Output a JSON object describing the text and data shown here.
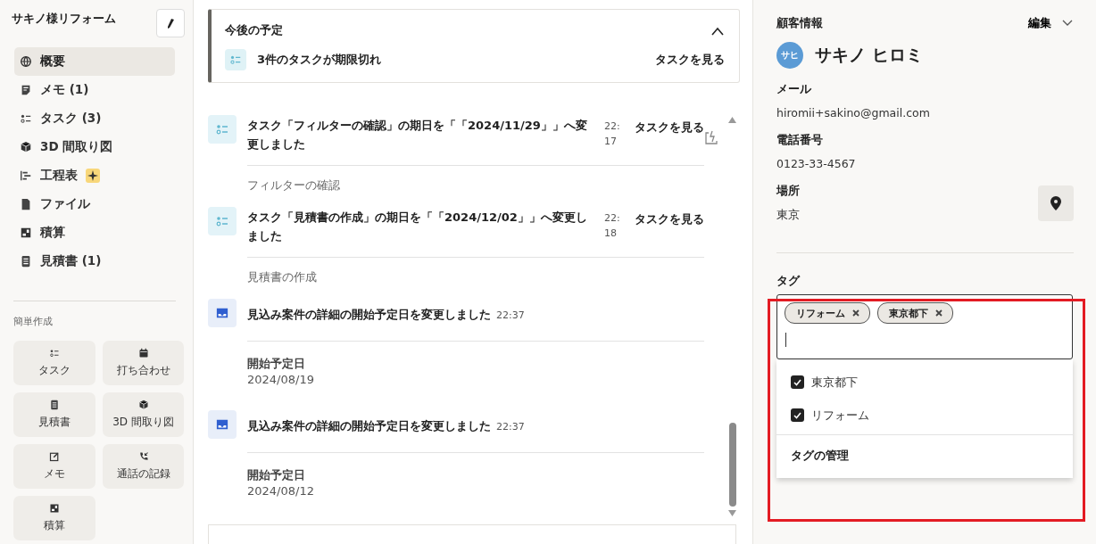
{
  "sidebar": {
    "title": "サキノ様リフォーム",
    "nav_items": [
      {
        "label": "概要",
        "selected": true
      },
      {
        "label": "メモ (1)",
        "selected": false
      },
      {
        "label": "タスク (3)",
        "selected": false
      },
      {
        "label": "3D 間取り図",
        "selected": false
      },
      {
        "label": "工程表",
        "selected": false
      },
      {
        "label": "ファイル",
        "selected": false
      },
      {
        "label": "積算",
        "selected": false
      },
      {
        "label": "見積書 (1)",
        "selected": false
      }
    ],
    "quick_create": {
      "heading": "簡単作成",
      "buttons": [
        {
          "label": "タスク"
        },
        {
          "label": "打ち合わせ"
        },
        {
          "label": "見積書"
        },
        {
          "label": "3D 間取り図"
        },
        {
          "label": "メモ"
        },
        {
          "label": "通話の記録"
        },
        {
          "label": "積算"
        }
      ]
    }
  },
  "upcoming": {
    "title": "今後の予定",
    "expanded": true,
    "item": {
      "text": "3件のタスクが期限切れ",
      "action": "タスクを見る"
    }
  },
  "feed": [
    {
      "kind": "task",
      "text": "タスク「フィルターの確認」の期日を「「2024/11/29」」へ変更しました",
      "time": "22:17",
      "action": "タスクを見る"
    },
    {
      "kind": "caption",
      "text": "フィルターの確認"
    },
    {
      "kind": "task",
      "text": "タスク「見積書の作成」の期日を「「2024/12/02」」へ変更しました",
      "time": "22:18",
      "action": "タスクを見る"
    },
    {
      "kind": "caption",
      "text": "見積書の作成"
    },
    {
      "kind": "event",
      "text": "見込み案件の詳細の開始予定日を変更しました",
      "time": "22:37"
    },
    {
      "kind": "field",
      "label": "開始予定日",
      "value": "2024/08/19"
    },
    {
      "kind": "event",
      "text": "見込み案件の詳細の開始予定日を変更しました",
      "time": "22:37"
    },
    {
      "kind": "field",
      "label": "開始予定日",
      "value": "2024/08/12"
    }
  ],
  "customer": {
    "heading": "顧客情報",
    "edit": "編集",
    "avatar": {
      "initials": "サヒ",
      "color": "#5b9bd5"
    },
    "name": "サキノ ヒロミ",
    "fields": [
      {
        "label": "メール",
        "value": "hiromii+sakino@gmail.com"
      },
      {
        "label": "電話番号",
        "value": "0123-33-4567"
      },
      {
        "label": "場所",
        "value": "東京"
      }
    ],
    "tags": {
      "label": "タグ",
      "chips": [
        "リフォーム",
        "東京都下"
      ],
      "options": [
        {
          "label": "東京都下",
          "checked": true
        },
        {
          "label": "リフォーム",
          "checked": true
        }
      ],
      "manage": "タグの管理"
    }
  }
}
